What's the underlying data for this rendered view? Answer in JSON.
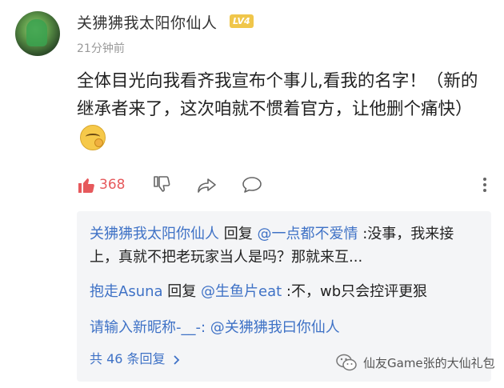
{
  "comment": {
    "username": "关狒狒我太阳你仙人",
    "level": "LV4",
    "time": "21分钟前",
    "text": "全体目光向我看齐我宣布个事儿,看我的名字！（新的继承者来了，这次咱就不惯着官方，让他删个痛快）",
    "like_count": "368",
    "emoji_name": "sly-face-emoji"
  },
  "replies": [
    {
      "author": "关狒狒我太阳你仙人",
      "verb": "回复",
      "target": "@一点都不爱情",
      "text": ":没事，我来接上，真就不把老玩家当人是吗？那就来互..."
    },
    {
      "author": "抱走Asuna",
      "verb": "回复",
      "target": "@生鱼片eat",
      "text": ":不，wb只会控评更狠"
    },
    {
      "author": "请输入新昵称-__-",
      "verb": "",
      "target": ": @关狒狒我曰你仙人",
      "text": ""
    }
  ],
  "more_replies": "共 46 条回复",
  "watermark": {
    "text": "仙友Game张的大仙礼包"
  },
  "colors": {
    "accent_blue": "#3f72c6",
    "like_red": "#e6595c",
    "level_yellow": "#f0c64a"
  }
}
